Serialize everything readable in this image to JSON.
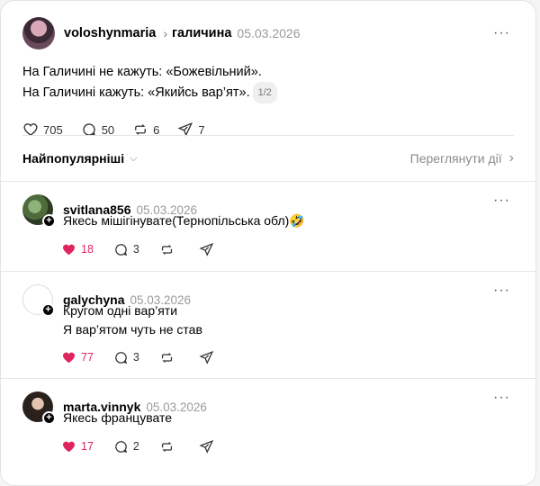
{
  "post": {
    "username": "voloshynmaria",
    "channel": "галичина",
    "date": "05.03.2026",
    "line1": "На Галичині не кажуть: «Божевільний».",
    "line2": "На Галичині кажуть: «Якийсь вар’ят».",
    "page": "1/2",
    "likes": "705",
    "comments": "50",
    "reposts": "6",
    "shares": "7"
  },
  "sort": {
    "label": "Найпопулярніші",
    "view_activity": "Переглянути дії"
  },
  "comments": [
    {
      "username": "svitlana856",
      "date": "05.03.2026",
      "lines": [
        "Якесь мішігінувате(Тернопільська обл)🤣"
      ],
      "likes": "18",
      "replies": "3"
    },
    {
      "username": "galychyna",
      "date": "05.03.2026",
      "lines": [
        "Кругом одні вар’яти",
        "Я вар’ятом чуть не став"
      ],
      "likes": "77",
      "replies": "3"
    },
    {
      "username": "marta.vinnyk",
      "date": "05.03.2026",
      "lines": [
        "Якесь францувате"
      ],
      "likes": "17",
      "replies": "2"
    }
  ],
  "icons": {
    "like": "heart-icon",
    "comment": "comment-bubble-icon",
    "repost": "repost-icon",
    "share": "send-icon",
    "more": "more-dots-icon"
  },
  "colors": {
    "liked": "#e0245e"
  }
}
